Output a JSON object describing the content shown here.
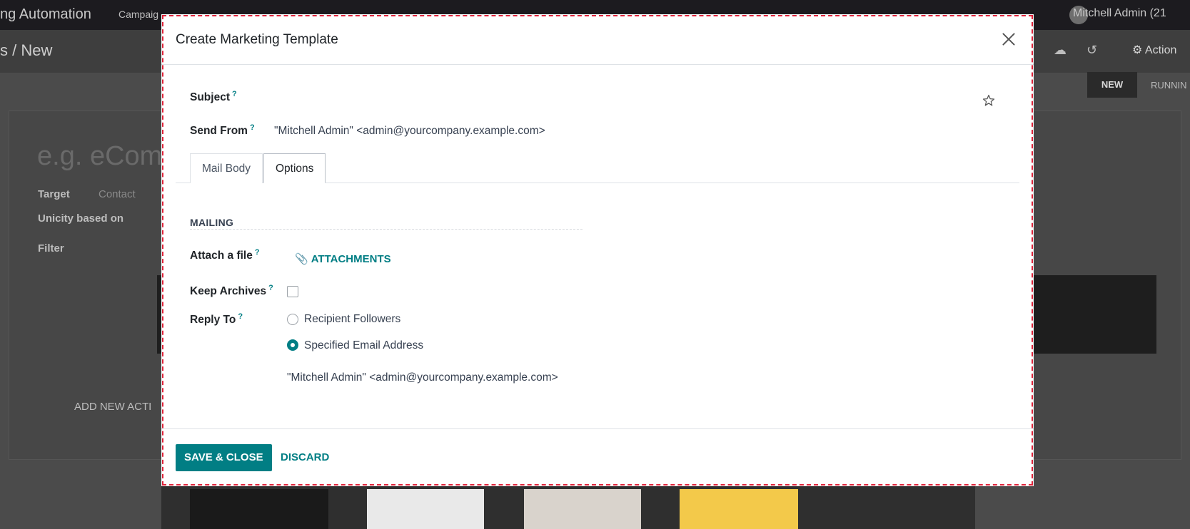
{
  "background": {
    "app_name": "ng Automation",
    "menu_item": "Campaig",
    "user_name": "Mitchell Admin (21",
    "breadcrumb": "s / New",
    "action_label": "Action",
    "status_new": "NEW",
    "status_running": "RUNNIN",
    "title_placeholder": "e.g. eCom",
    "target_label": "Target",
    "target_value": "Contact",
    "unicity_label": "Unicity based on",
    "filter_label": "Filter",
    "add_new_activity": "ADD NEW ACTI"
  },
  "modal": {
    "title": "Create Marketing Template",
    "subject_label": "Subject",
    "send_from_label": "Send From",
    "send_from_value": "\"Mitchell Admin\" <admin@yourcompany.example.com>",
    "tabs": [
      {
        "label": "Mail Body",
        "active": false
      },
      {
        "label": "Options",
        "active": true
      }
    ],
    "section_mailing": "MAILING",
    "attach_label": "Attach a file",
    "attachments_button": "ATTACHMENTS",
    "keep_archives_label": "Keep Archives",
    "keep_archives_checked": false,
    "reply_to_label": "Reply To",
    "reply_options": [
      {
        "label": "Recipient Followers",
        "selected": false
      },
      {
        "label": "Specified Email Address",
        "selected": true
      }
    ],
    "reply_to_value": "\"Mitchell Admin\" <admin@yourcompany.example.com>",
    "tooltip_marker": "?",
    "save_button": "SAVE & CLOSE",
    "discard_button": "DISCARD"
  },
  "colors": {
    "accent": "#017e84",
    "modal_outline": "#e0243b"
  },
  "icons": {
    "close": "close-icon",
    "star": "star-icon",
    "attachment": "paperclip-icon"
  }
}
